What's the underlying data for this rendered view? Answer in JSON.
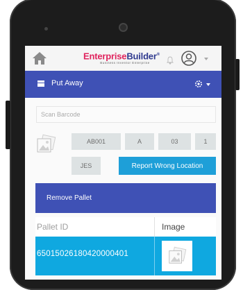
{
  "header": {
    "logo_text": "EnterpriseBuilder",
    "logo_tagline": "Business Inventor Enterprise"
  },
  "titlebar": {
    "title": "Put Away"
  },
  "scan": {
    "placeholder": "Scan Barcode"
  },
  "location": {
    "cells": [
      "AB001",
      "A",
      "03",
      "1"
    ],
    "extra": "JES"
  },
  "buttons": {
    "report_wrong_location": "Report Wrong Location",
    "remove_pallet": "Remove Pallet"
  },
  "table": {
    "headers": {
      "pallet_id": "Pallet ID",
      "image": "Image"
    },
    "rows": [
      {
        "pallet_id": "65015026180420000401"
      }
    ]
  },
  "colors": {
    "primary": "#3f51b5",
    "accent": "#1e9fd8",
    "row_selected": "#0fa8e0",
    "brand_pink": "#e0245e"
  },
  "icons": [
    "home-icon",
    "bell-icon",
    "user-icon",
    "menu-icon",
    "gear-icon",
    "photo-icon"
  ]
}
